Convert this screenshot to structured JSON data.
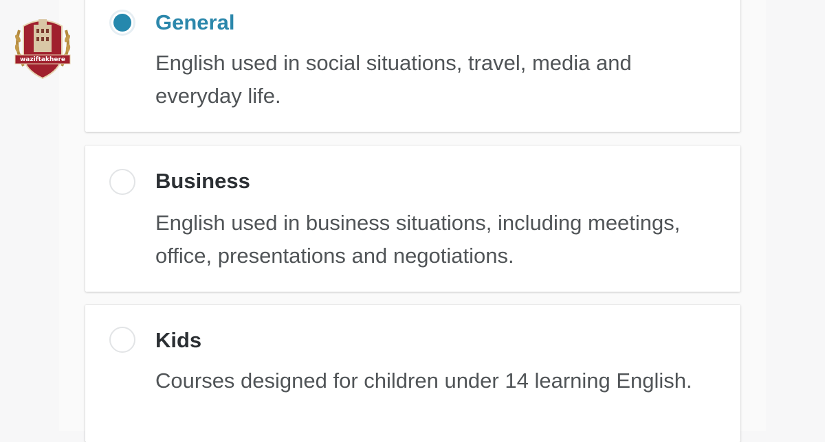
{
  "logo": {
    "text": "waziftakhere"
  },
  "options": [
    {
      "title": "General",
      "description": "English used in social situations, travel, media and everyday life.",
      "selected": true
    },
    {
      "title": "Business",
      "description": "English used in business situations, including meetings, office, presentations and negotiations.",
      "selected": false
    },
    {
      "title": "Kids",
      "description": "Courses designed for children under 14 learning English.",
      "selected": false
    }
  ],
  "colors": {
    "accent": "#2588ad",
    "title_text": "#2b2f33",
    "body_text": "#505457",
    "logo_red": "#a0202e",
    "logo_gold": "#b38a3e"
  }
}
